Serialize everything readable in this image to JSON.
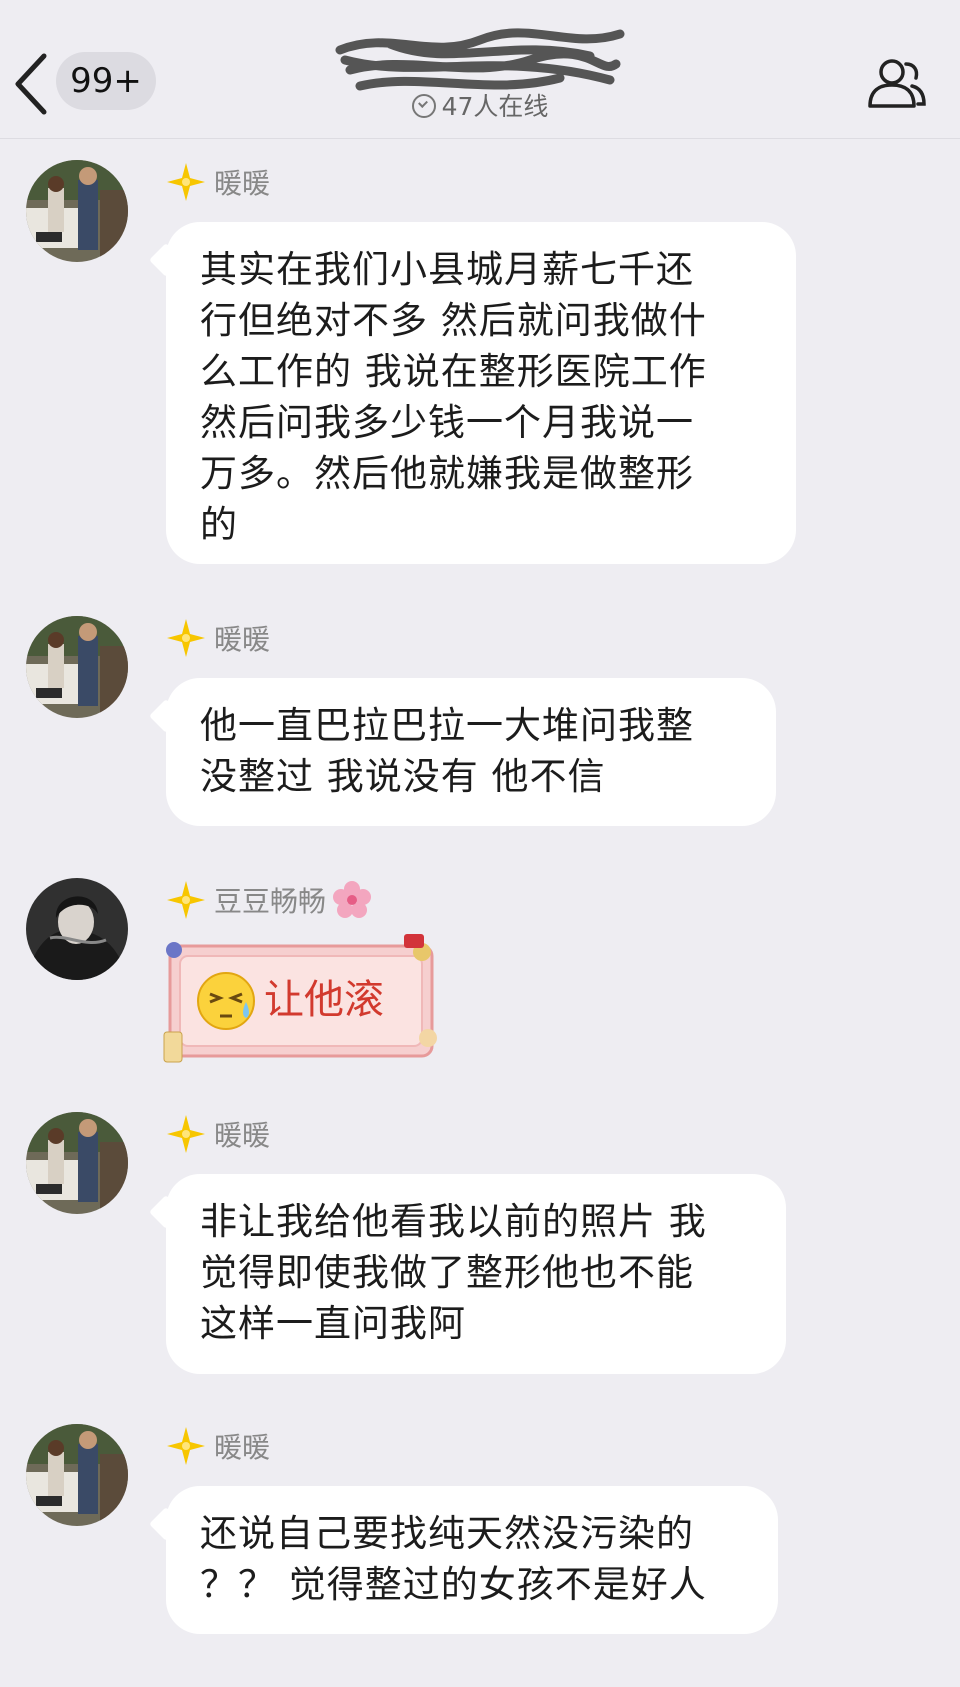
{
  "header": {
    "unread_badge": "99+",
    "online_text": "47人在线",
    "icons": {
      "back": "chevron-left-icon",
      "online": "check-circle-icon",
      "members": "group-members-icon"
    }
  },
  "messages": [
    {
      "nickname": "暖暖",
      "text": "其实在我们小县城月薪七千还\n行但绝对不多 然后就问我做什\n么工作的 我说在整形医院工作\n然后问我多少钱一个月我说一\n万多。然后他就嫌我是做整形\n的"
    },
    {
      "nickname": "暖暖",
      "text": "他一直巴拉巴拉一大堆问我整\n没整过 我说没有 他不信"
    },
    {
      "nickname": "豆豆畅畅",
      "sticker_text": "让他滚"
    },
    {
      "nickname": "暖暖",
      "text": "非让我给他看我以前的照片 我\n觉得即使我做了整形他也不能\n这样一直问我阿"
    },
    {
      "nickname": "暖暖",
      "text": "还说自己要找纯天然没污染的\n？？ 觉得整过的女孩不是好人"
    }
  ],
  "colors": {
    "background": "#eeedf2",
    "bubble": "#ffffff",
    "badge_star": "#f7c600",
    "sticker_text": "#d23a2e"
  }
}
